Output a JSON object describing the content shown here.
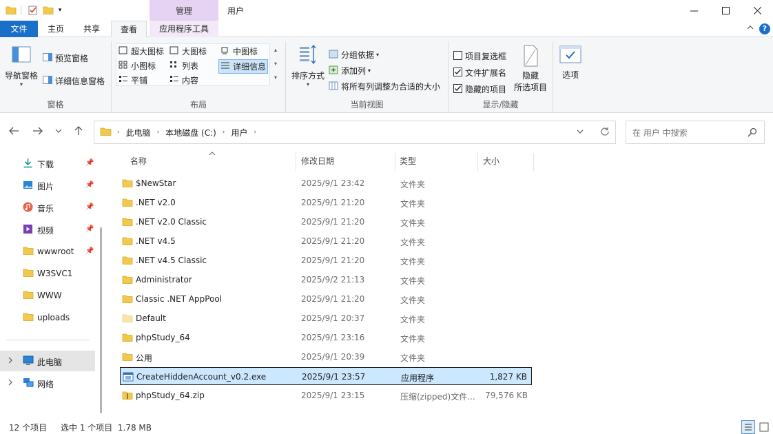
{
  "titlebar": {
    "manage_tab": "管理",
    "title": "用户",
    "minimize": "—",
    "maximize": "☐",
    "close": "✕"
  },
  "tabs": {
    "file": "文件",
    "home": "主页",
    "share": "共享",
    "view": "查看",
    "app_tools": "应用程序工具"
  },
  "ribbon": {
    "panes": {
      "label": "窗格",
      "nav_pane": "导航窗格",
      "preview_pane": "预览窗格",
      "details_pane": "详细信息窗格"
    },
    "layout": {
      "label": "布局",
      "extra_large": "超大图标",
      "large": "大图标",
      "medium": "中图标",
      "small": "小图标",
      "list": "列表",
      "details": "详细信息",
      "tiles": "平铺",
      "content": "内容"
    },
    "current_view": {
      "label": "当前视图",
      "sort_by": "排序方式",
      "group_by": "分组依据",
      "add_columns": "添加列",
      "size_all_columns": "将所有列调整为合适的大小"
    },
    "show_hide": {
      "label": "显示/隐藏",
      "item_checkboxes": "项目复选框",
      "item_checkboxes_checked": false,
      "file_extensions": "文件扩展名",
      "file_extensions_checked": true,
      "hidden_items": "隐藏的项目",
      "hidden_items_checked": true,
      "hide_selected_1": "隐藏",
      "hide_selected_2": "所选项目"
    },
    "options": "选项"
  },
  "address": {
    "crumbs": [
      "此电脑",
      "本地磁盘 (C:)",
      "用户"
    ]
  },
  "search": {
    "placeholder": "在 用户 中搜索"
  },
  "sidebar": {
    "items": [
      {
        "label": "下载",
        "icon": "download-icon",
        "pinned": true
      },
      {
        "label": "图片",
        "icon": "pictures-icon",
        "pinned": true
      },
      {
        "label": "音乐",
        "icon": "music-icon",
        "pinned": true
      },
      {
        "label": "视频",
        "icon": "video-icon",
        "pinned": true
      },
      {
        "label": "wwwroot",
        "icon": "folder-icon",
        "pinned": true
      },
      {
        "label": "W3SVC1",
        "icon": "folder-icon",
        "pinned": false
      },
      {
        "label": "WWW",
        "icon": "folder-icon",
        "pinned": false
      },
      {
        "label": "uploads",
        "icon": "folder-icon",
        "pinned": false
      }
    ],
    "this_pc": "此电脑",
    "network": "网络"
  },
  "columns": {
    "name": "名称",
    "date": "修改日期",
    "type": "类型",
    "size": "大小"
  },
  "files": [
    {
      "name": "$NewStar",
      "date": "2025/9/1 23:42",
      "type": "文件夹",
      "size": "",
      "icon": "folder-icon"
    },
    {
      "name": ".NET v2.0",
      "date": "2025/9/1 21:20",
      "type": "文件夹",
      "size": "",
      "icon": "folder-icon"
    },
    {
      "name": ".NET v2.0 Classic",
      "date": "2025/9/1 21:20",
      "type": "文件夹",
      "size": "",
      "icon": "folder-icon"
    },
    {
      "name": ".NET v4.5",
      "date": "2025/9/1 21:20",
      "type": "文件夹",
      "size": "",
      "icon": "folder-icon"
    },
    {
      "name": ".NET v4.5 Classic",
      "date": "2025/9/1 21:20",
      "type": "文件夹",
      "size": "",
      "icon": "folder-icon"
    },
    {
      "name": "Administrator",
      "date": "2025/9/2 21:13",
      "type": "文件夹",
      "size": "",
      "icon": "folder-icon"
    },
    {
      "name": "Classic .NET AppPool",
      "date": "2025/9/1 21:20",
      "type": "文件夹",
      "size": "",
      "icon": "folder-icon"
    },
    {
      "name": "Default",
      "date": "2025/9/1 20:37",
      "type": "文件夹",
      "size": "",
      "icon": "folder-faded-icon"
    },
    {
      "name": "phpStudy_64",
      "date": "2025/9/1 23:16",
      "type": "文件夹",
      "size": "",
      "icon": "folder-icon"
    },
    {
      "name": "公用",
      "date": "2025/9/1 20:39",
      "type": "文件夹",
      "size": "",
      "icon": "folder-icon"
    },
    {
      "name": "CreateHiddenAccount_v0.2.exe",
      "date": "2025/9/1 23:57",
      "type": "应用程序",
      "size": "1,827 KB",
      "icon": "exe-icon",
      "selected": true
    },
    {
      "name": "phpStudy_64.zip",
      "date": "2025/9/1 23:15",
      "type": "压缩(zipped)文件...",
      "size": "79,576 KB",
      "icon": "zip-icon"
    }
  ],
  "status": {
    "count": "12 个项目",
    "selection": "选中 1 个项目  1.78 MB"
  }
}
